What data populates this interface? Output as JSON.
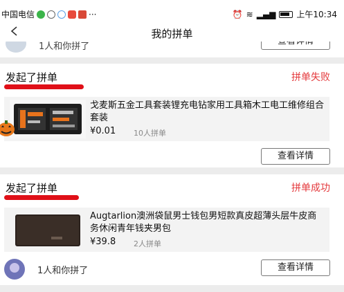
{
  "status_bar": {
    "carrier": "中国电信",
    "more": "···",
    "time": "上午10:34"
  },
  "nav": {
    "title": "我的拼单"
  },
  "top_card": {
    "joined_text": "1人和你拼了",
    "detail_label": "查看详情"
  },
  "orders": [
    {
      "title": "发起了拼单",
      "status": "拼单失败",
      "product_name": "戈麦斯五金工具套装锂充电钻家用工具箱木工电工维修组合套装",
      "price": "¥0.01",
      "group_size": "10人拼单",
      "detail_label": "查看详情"
    },
    {
      "title": "发起了拼单",
      "status": "拼单成功",
      "product_name": "Augtarlion澳洲袋鼠男士钱包男短款真皮超薄头层牛皮商务休闲青年钱夹男包",
      "price": "¥39.8",
      "group_size": "2人拼单",
      "joined_text": "1人和你拼了",
      "detail_label": "查看详情"
    }
  ],
  "colors": {
    "accent": "#e4393c",
    "background": "#ececec"
  }
}
